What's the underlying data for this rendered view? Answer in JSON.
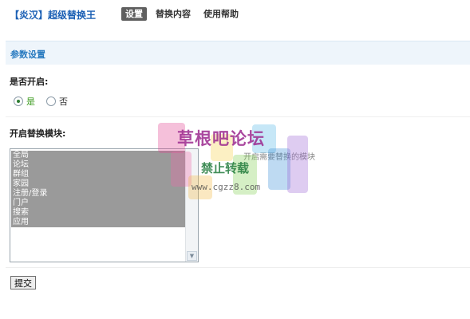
{
  "header": {
    "app_title": "【炎汉】超级替换王",
    "tabs": [
      {
        "label": "设置",
        "active": true
      },
      {
        "label": "替换内容",
        "active": false
      },
      {
        "label": "使用帮助",
        "active": false
      }
    ]
  },
  "section": {
    "title": "参数设置"
  },
  "enable": {
    "label": "是否开启:",
    "options": [
      {
        "label": "是",
        "checked": true
      },
      {
        "label": "否",
        "checked": false
      }
    ]
  },
  "modules": {
    "label": "开启替换模块:",
    "items": [
      "全局",
      "论坛",
      "群组",
      "家园",
      "注册/登录",
      "门户",
      "搜索",
      "应用"
    ],
    "hint": "开启需要替换的模块"
  },
  "form": {
    "submit_label": "提交"
  },
  "watermark": {
    "title": "草根吧论坛",
    "subtitle": "禁止转载",
    "url": "www.cgzz8.com"
  },
  "colors": {
    "title_blue": "#1a5fb4",
    "section_bg": "#eef5fb",
    "section_text": "#2a7bc0",
    "active_tab_bg": "#5f5f5f",
    "selected_item_bg": "#9a9a9a"
  }
}
